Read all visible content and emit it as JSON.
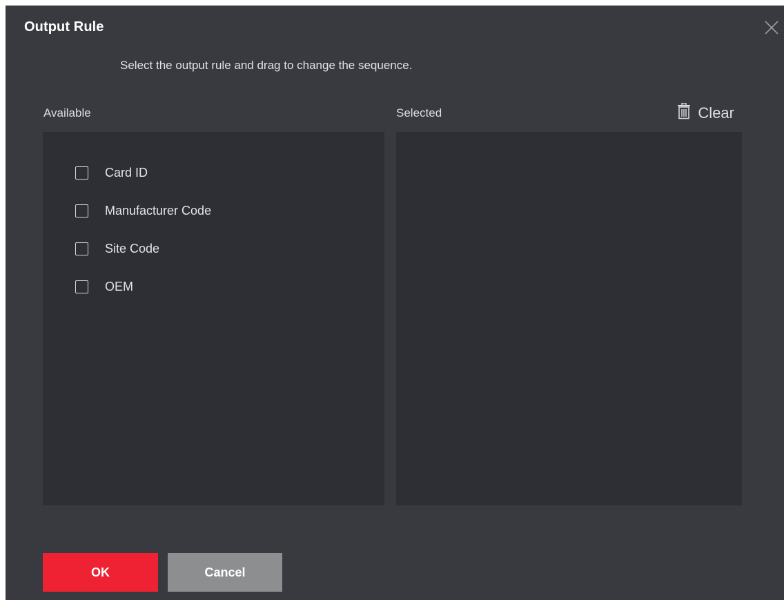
{
  "dialog": {
    "title": "Output Rule",
    "hint": "Select the output rule and drag to change the sequence."
  },
  "available": {
    "label": "Available",
    "items": [
      {
        "label": "Card ID",
        "checked": false
      },
      {
        "label": "Manufacturer Code",
        "checked": false
      },
      {
        "label": "Site Code",
        "checked": false
      },
      {
        "label": "OEM",
        "checked": false
      }
    ]
  },
  "selected": {
    "label": "Selected",
    "clear_label": "Clear",
    "items": []
  },
  "buttons": {
    "ok_label": "OK",
    "cancel_label": "Cancel"
  },
  "icons": {
    "close": "close-icon",
    "clear": "trash-icon"
  },
  "colors": {
    "dialog_bg": "#383a3f",
    "panel_bg": "#2d2f34",
    "primary": "#ee2232",
    "secondary": "#8d8e90"
  }
}
